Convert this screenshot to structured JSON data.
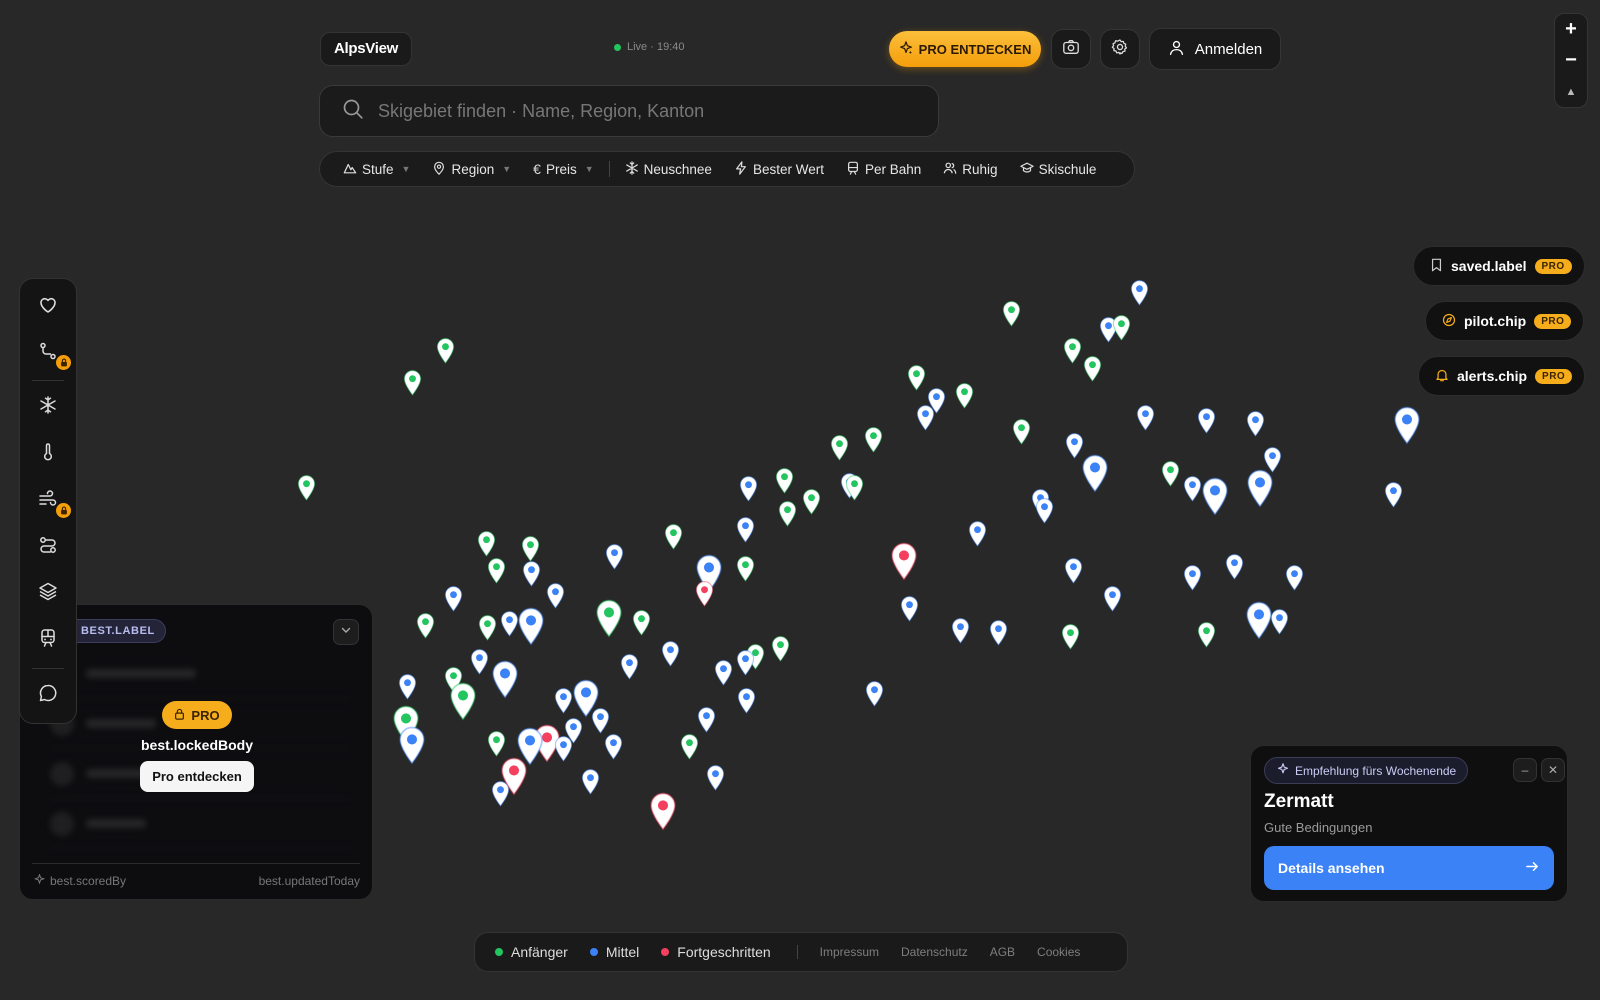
{
  "brand": {
    "name": "AlpsView"
  },
  "status": {
    "live_text": "Live · 19:40"
  },
  "header": {
    "pro_button_label": "PRO ENTDECKEN",
    "camera_icon": "camera-icon",
    "settings_icon": "gear-icon",
    "login_label": "Anmelden"
  },
  "zoom": {
    "in_label": "+",
    "out_label": "−",
    "compass_label": "▲"
  },
  "search": {
    "placeholder": "Skigebiet finden · Name, Region, Kanton",
    "value": ""
  },
  "filters": [
    {
      "label": "Stufe",
      "icon": "mountain-icon",
      "dropdown": true
    },
    {
      "label": "Region",
      "icon": "location-pin-icon",
      "dropdown": true
    },
    {
      "label": "Preis",
      "icon": "euro-icon",
      "dropdown": true
    },
    {
      "label": "Neuschnee",
      "icon": "snowflake-icon",
      "dropdown": false
    },
    {
      "label": "Bester Wert",
      "icon": "lightning-icon",
      "dropdown": false
    },
    {
      "label": "Per Bahn",
      "icon": "train-icon",
      "dropdown": false
    },
    {
      "label": "Ruhig",
      "icon": "people-icon",
      "dropdown": false
    },
    {
      "label": "Skischule",
      "icon": "graduation-cap-icon",
      "dropdown": false
    }
  ],
  "right_chips": [
    {
      "label": "saved.label",
      "icon": "bookmark-icon",
      "badge": "PRO"
    },
    {
      "label": "pilot.chip",
      "icon": "compass-icon",
      "badge": "PRO"
    },
    {
      "label": "alerts.chip",
      "icon": "bell-icon",
      "badge": "PRO"
    }
  ],
  "sidebar": [
    {
      "icon": "heart-icon",
      "locked": false
    },
    {
      "icon": "route-icon",
      "locked": true
    },
    {
      "icon": "snowflake-icon",
      "locked": false
    },
    {
      "icon": "thermometer-icon",
      "locked": false
    },
    {
      "icon": "wind-icon",
      "locked": true
    },
    {
      "icon": "slopes-icon",
      "locked": false
    },
    {
      "icon": "layers-icon",
      "locked": false
    },
    {
      "icon": "train-icon",
      "locked": false
    },
    {
      "icon": "chat-icon",
      "locked": false
    }
  ],
  "best_panel": {
    "tag": "BEST.LABEL",
    "pro_badge": "PRO",
    "locked_body": "best.lockedBody",
    "cta_label": "Pro entdecken",
    "footer_left": "best.scoredBy",
    "footer_right": "best.updatedToday"
  },
  "recommendation": {
    "tag": "Empfehlung fürs Wochenende",
    "title": "Zermatt",
    "subtitle": "Gute Bedingungen",
    "button_label": "Details ansehen",
    "minimize_label": "–",
    "close_label": "✕"
  },
  "legend": {
    "items": [
      {
        "label": "Anfänger",
        "color": "#22c55e"
      },
      {
        "label": "Mittel",
        "color": "#3b82f6"
      },
      {
        "label": "Fortgeschritten",
        "color": "#f43f5e"
      }
    ],
    "links": [
      "Impressum",
      "Datenschutz",
      "AGB",
      "Cookies"
    ]
  },
  "colors": {
    "beginner": "#22c55e",
    "intermediate": "#3b82f6",
    "advanced": "#f43f5e",
    "pro_accent": "#f59e0b",
    "primary_button": "#3b82f6",
    "map_background": "#282828"
  }
}
